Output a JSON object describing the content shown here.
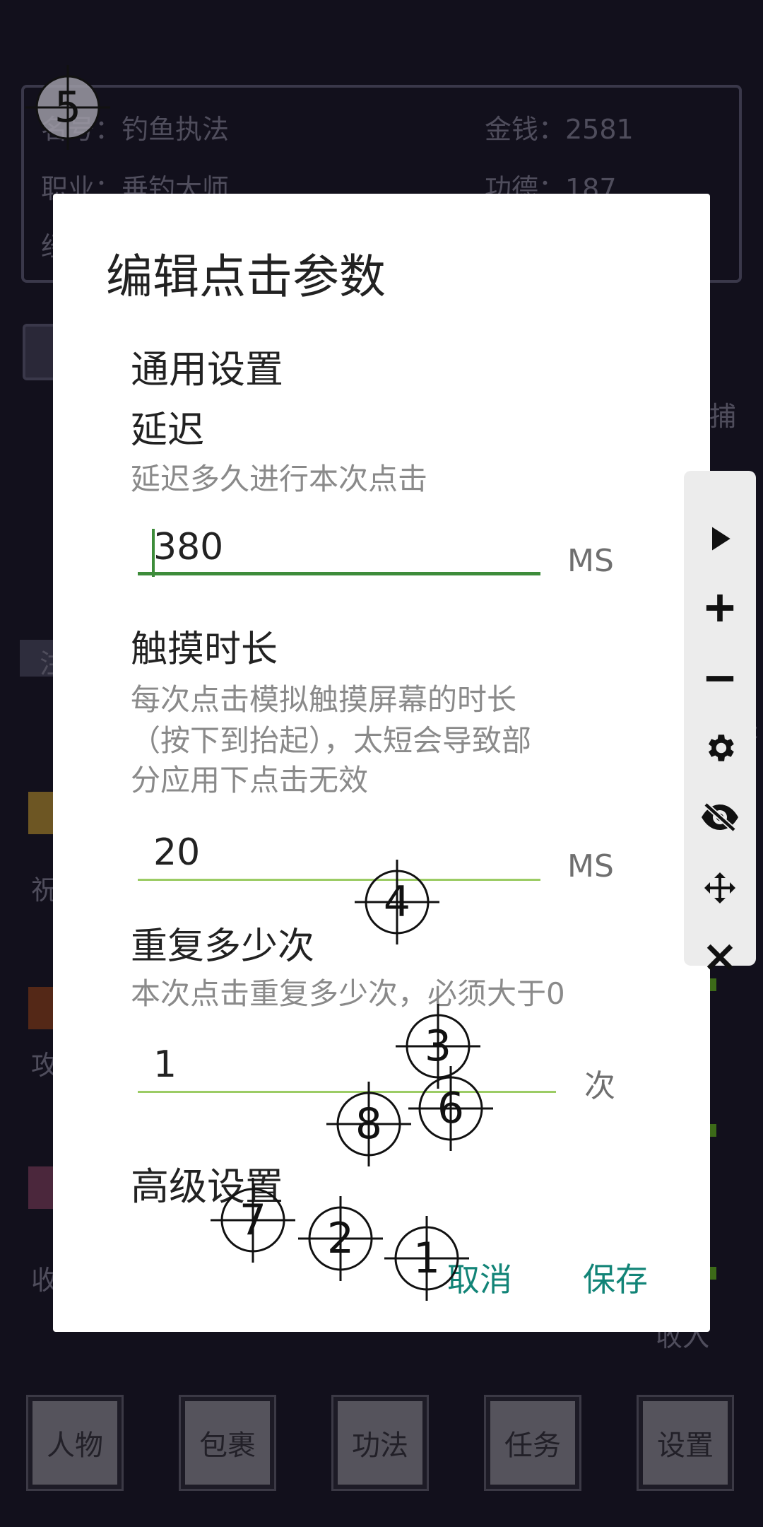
{
  "background": {
    "name_label": "名号：钓鱼执法",
    "money_label": "金钱：2581",
    "job_label": "职业：垂钓大师",
    "merit_label": "功德：187",
    "partial_left_1": "经",
    "partial_right_1": "捕",
    "partial_tag": "注",
    "partial_left_2": "祝",
    "partial_left_3": "攻",
    "partial_left_4": "收",
    "partial_right_2": "咨",
    "partial_right_3": "收入",
    "nav": [
      "人物",
      "包裹",
      "功法",
      "任务",
      "设置"
    ]
  },
  "dialog": {
    "title": "编辑点击参数",
    "general_section": "通用设置",
    "delay": {
      "label": "延迟",
      "hint": "延迟多久进行本次点击",
      "value": "380",
      "unit": "MS"
    },
    "touch": {
      "label": "触摸时长",
      "hint_lines": [
        "每次点击模拟触摸屏幕的时长",
        "（按下到抬起），太短会导致部",
        "分应用下点击无效"
      ],
      "value": "20",
      "unit": "MS"
    },
    "repeat": {
      "label": "重复多少次",
      "hint": "本次点击重复多少次，必须大于0",
      "value": "1",
      "unit": "次"
    },
    "advanced_section": "高级设置",
    "cancel_label": "取消",
    "save_label": "保存"
  },
  "toolbar": {
    "items": [
      "play-icon",
      "plus-icon",
      "minus-icon",
      "gear-icon",
      "eye-off-icon",
      "move-icon",
      "close-icon"
    ]
  },
  "markers": [
    "1",
    "2",
    "3",
    "4",
    "5",
    "6",
    "7",
    "8"
  ],
  "colors": {
    "accent_green": "#3d8c3a",
    "light_green": "#9ccc65",
    "button_teal": "#128477",
    "background": "#12101c"
  }
}
